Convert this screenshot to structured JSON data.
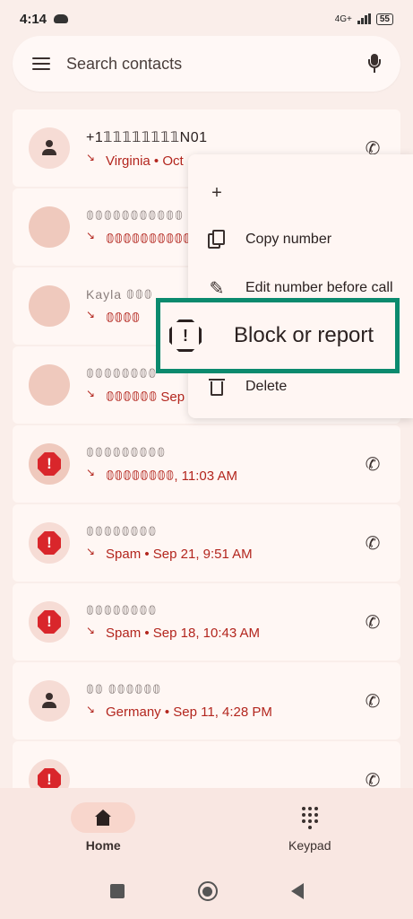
{
  "status_bar": {
    "time": "4:14",
    "network": "4G+",
    "battery": "55"
  },
  "search": {
    "placeholder": "Search contacts"
  },
  "calls": [
    {
      "name": "+1𝟙𝟙𝟙𝟙𝟙𝟙𝟙𝟙N01",
      "detail": "Virginia • Oct",
      "avatar": "person",
      "faded": false
    },
    {
      "name": "𝟘𝟘𝟘𝟘𝟘𝟘𝟘𝟘𝟘𝟘𝟘",
      "detail": "𝟘𝟘𝟘𝟘𝟘𝟘𝟘𝟘𝟘𝟘",
      "avatar": "photo",
      "faded": true
    },
    {
      "name": "Kayla 𝟘𝟘𝟘",
      "detail": "𝟘𝟘𝟘𝟘",
      "avatar": "photo",
      "faded": true
    },
    {
      "name": "𝟘𝟘𝟘𝟘𝟘𝟘𝟘𝟘",
      "detail": "𝟘𝟘𝟘𝟘𝟘𝟘 Sep",
      "avatar": "photo",
      "faded": true
    },
    {
      "name": "𝟘𝟘𝟘𝟘𝟘𝟘𝟘𝟘𝟘",
      "detail": "𝟘𝟘𝟘𝟘𝟘𝟘𝟘𝟘, 11:03 AM",
      "avatar": "spam-photo",
      "faded": true
    },
    {
      "name": "𝟘𝟘𝟘𝟘𝟘𝟘𝟘𝟘",
      "detail": "Spam • Sep 21, 9:51 AM",
      "avatar": "spam",
      "faded": true
    },
    {
      "name": "𝟘𝟘𝟘𝟘𝟘𝟘𝟘𝟘",
      "detail": "Spam • Sep 18, 10:43 AM",
      "avatar": "spam",
      "faded": true
    },
    {
      "name": "𝟘𝟘 𝟘𝟘𝟘𝟘𝟘𝟘",
      "detail": "Germany • Sep 11, 4:28 PM",
      "avatar": "person",
      "faded": true
    },
    {
      "name": "",
      "detail": "",
      "avatar": "spam",
      "faded": true
    }
  ],
  "menu": {
    "add_contact_glyph": "+",
    "copy_number": "Copy number",
    "edit_number": "Edit number before call",
    "block_or_report": "Block or report",
    "delete": "Delete"
  },
  "bottom_nav": {
    "home": "Home",
    "keypad": "Keypad"
  },
  "colors": {
    "highlight_border": "#0b8a6e",
    "spam_red": "#d9262b",
    "missed_red": "#b3261e"
  }
}
